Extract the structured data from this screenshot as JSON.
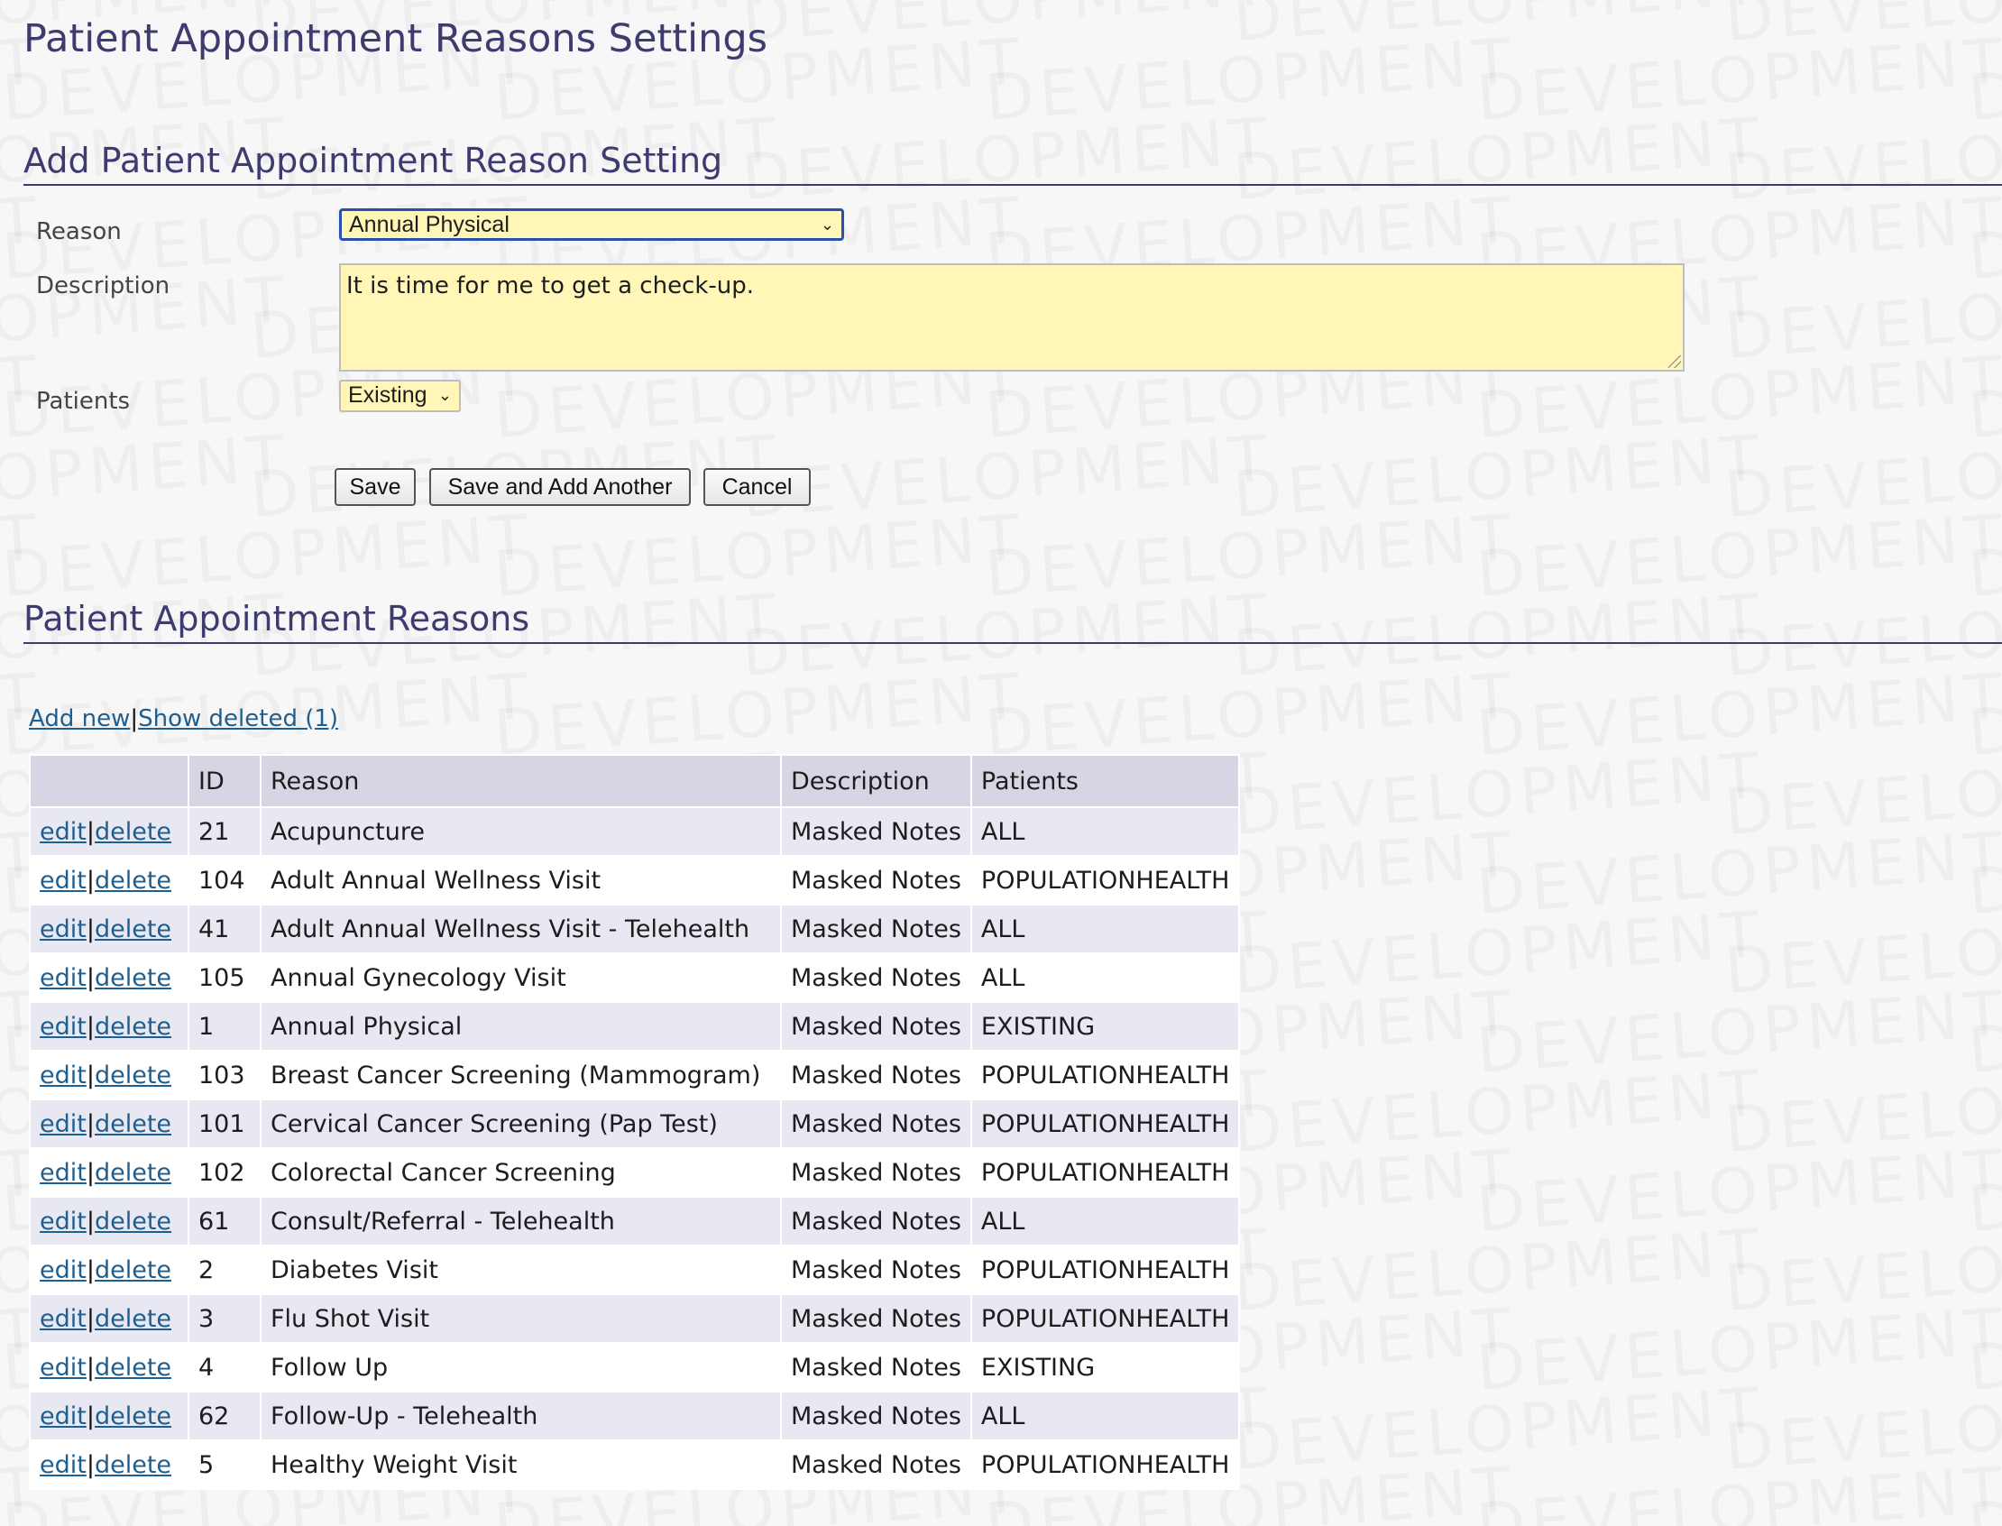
{
  "watermark_text": "DEVELOPMENT",
  "page_title": "Patient Appointment Reasons Settings",
  "add_form": {
    "heading": "Add Patient Appointment Reason Setting",
    "reason_label": "Reason",
    "reason_value": "Annual Physical",
    "description_label": "Description",
    "description_value": "It is time for me to get a check-up.",
    "patients_label": "Patients",
    "patients_value": "Existing",
    "buttons": {
      "save": "Save",
      "save_add": "Save and Add Another",
      "cancel": "Cancel"
    }
  },
  "list": {
    "heading": "Patient Appointment Reasons",
    "add_new": "Add new",
    "separator": "|",
    "show_deleted": "Show deleted (1)",
    "columns": [
      "",
      "ID",
      "Reason",
      "Description",
      "Patients"
    ],
    "row_actions": {
      "edit": "edit",
      "delete": "delete"
    },
    "rows": [
      {
        "id": "21",
        "reason": "Acupuncture",
        "description": "Masked Notes",
        "patients": "ALL"
      },
      {
        "id": "104",
        "reason": "Adult Annual Wellness Visit",
        "description": "Masked Notes",
        "patients": "POPULATIONHEALTH"
      },
      {
        "id": "41",
        "reason": "Adult Annual Wellness Visit - Telehealth",
        "description": "Masked Notes",
        "patients": "ALL"
      },
      {
        "id": "105",
        "reason": "Annual Gynecology Visit",
        "description": "Masked Notes",
        "patients": "ALL"
      },
      {
        "id": "1",
        "reason": "Annual Physical",
        "description": "Masked Notes",
        "patients": "EXISTING"
      },
      {
        "id": "103",
        "reason": "Breast Cancer Screening (Mammogram)",
        "description": "Masked Notes",
        "patients": "POPULATIONHEALTH"
      },
      {
        "id": "101",
        "reason": "Cervical Cancer Screening (Pap Test)",
        "description": "Masked Notes",
        "patients": "POPULATIONHEALTH"
      },
      {
        "id": "102",
        "reason": "Colorectal Cancer Screening",
        "description": "Masked Notes",
        "patients": "POPULATIONHEALTH"
      },
      {
        "id": "61",
        "reason": "Consult/Referral - Telehealth",
        "description": "Masked Notes",
        "patients": "ALL"
      },
      {
        "id": "2",
        "reason": "Diabetes Visit",
        "description": "Masked Notes",
        "patients": "POPULATIONHEALTH"
      },
      {
        "id": "3",
        "reason": "Flu Shot Visit",
        "description": "Masked Notes",
        "patients": "POPULATIONHEALTH"
      },
      {
        "id": "4",
        "reason": "Follow Up",
        "description": "Masked Notes",
        "patients": "EXISTING"
      },
      {
        "id": "62",
        "reason": "Follow-Up - Telehealth",
        "description": "Masked Notes",
        "patients": "ALL"
      },
      {
        "id": "5",
        "reason": "Healthy Weight Visit",
        "description": "Masked Notes",
        "patients": "POPULATIONHEALTH"
      }
    ]
  }
}
